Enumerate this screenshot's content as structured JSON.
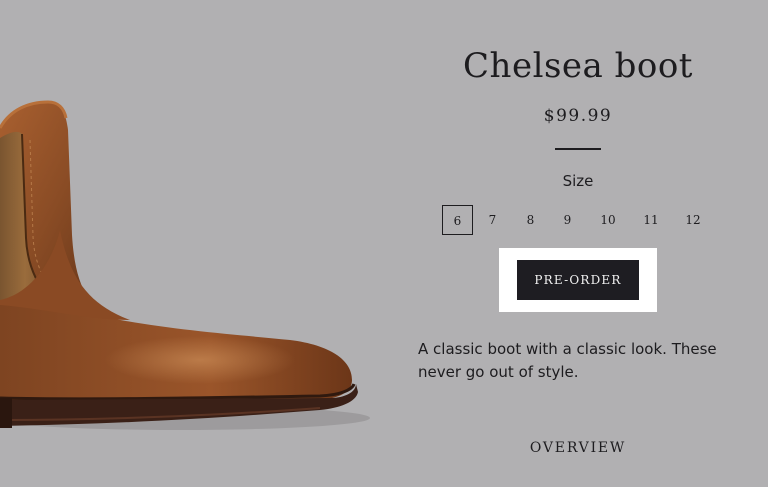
{
  "product": {
    "title": "Chelsea boot",
    "price": "$99.99",
    "size_label": "Size",
    "sizes": [
      "6",
      "7",
      "8",
      "9",
      "10",
      "11",
      "12"
    ],
    "selected_size": "6",
    "preorder_label": "PRE-ORDER",
    "description": "A classic boot with a classic look. These never go out of style.",
    "overview_label": "OVERVIEW"
  },
  "image": {
    "subject": "chelsea-boot-photo",
    "leather_color": "#8a4c25",
    "elastic_color": "#8f6437",
    "sole_color": "#3a2017"
  },
  "colors": {
    "background": "#b1b0b2",
    "button_bg": "#1e1d22",
    "button_highlight": "#ffffff",
    "text": "#1d1c1f"
  }
}
